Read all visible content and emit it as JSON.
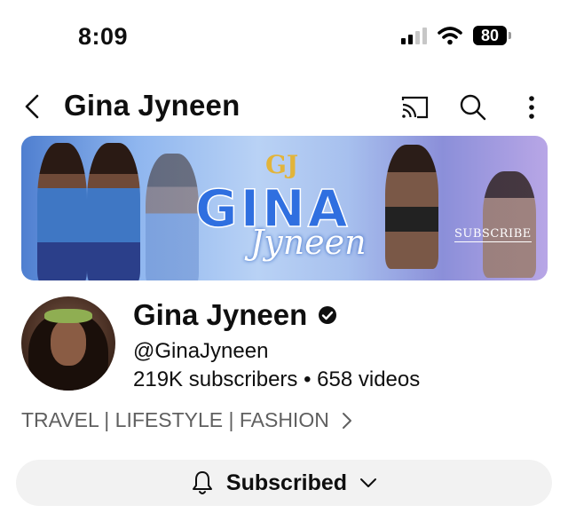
{
  "status_bar": {
    "time": "8:09",
    "battery": "80",
    "icons": [
      "signal-icon",
      "wifi-icon",
      "battery-icon"
    ]
  },
  "header": {
    "title": "Gina Jyneen",
    "icons": [
      "back-chevron-icon",
      "cast-icon",
      "search-icon",
      "more-vert-icon"
    ]
  },
  "banner": {
    "monogram": "GJ",
    "name": "GINA",
    "script": "Jyneen",
    "subscribe": "SUBSCRIBE"
  },
  "channel": {
    "name": "Gina Jyneen",
    "handle": "@GinaJyneen",
    "stats": "219K subscribers • 658 videos",
    "description": "TRAVEL | LIFESTYLE | FASHION"
  },
  "subscribe_button": {
    "label": "Subscribed",
    "icons": [
      "bell-icon",
      "chevron-down-icon"
    ]
  },
  "colors": {
    "accent": "#2f6fe0",
    "text": "#0f0f0f",
    "muted": "#606060",
    "button_bg": "#f2f2f2"
  }
}
